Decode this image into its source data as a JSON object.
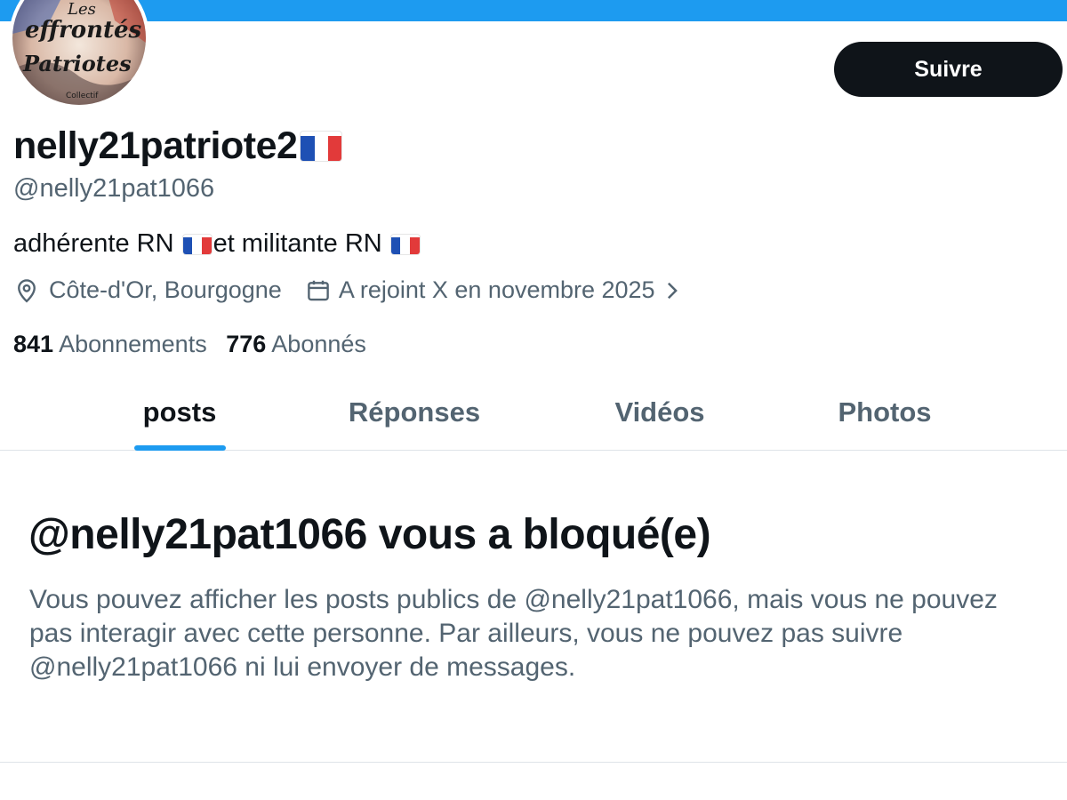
{
  "profile": {
    "display_name": "nelly21patriote2",
    "handle": "@nelly21pat1066",
    "bio_part1": "adhérente RN",
    "bio_part2": "et militante RN",
    "location": "Côte-d'Or, Bourgogne",
    "joined": "A rejoint X en novembre 2025",
    "following_count": "841",
    "following_label": "Abonnements",
    "followers_count": "776",
    "followers_label": "Abonnés",
    "avatar_text": {
      "line1": "Les",
      "line2": "effrontés",
      "line3": "Patriotes",
      "line4": "Collectif"
    }
  },
  "actions": {
    "follow_label": "Suivre"
  },
  "tabs": [
    {
      "label": "posts",
      "active": true
    },
    {
      "label": "Réponses",
      "active": false
    },
    {
      "label": "Vidéos",
      "active": false
    },
    {
      "label": "Photos",
      "active": false
    }
  ],
  "blocked": {
    "title": "@nelly21pat1066 vous a bloqué(e)",
    "message": "Vous pouvez afficher les posts publics de @nelly21pat1066, mais vous ne pouvez pas interagir avec cette personne. Par ailleurs, vous ne pouvez pas suivre @nelly21pat1066 ni lui envoyer de messages."
  },
  "icons": {
    "location": "location-pin-icon",
    "calendar": "calendar-icon",
    "chevron": "chevron-right-icon",
    "flag": "france-flag-emoji"
  },
  "colors": {
    "accent": "#1d9bf0",
    "text_primary": "#0f1419",
    "text_secondary": "#536471",
    "button_bg": "#0f1419",
    "button_text": "#ffffff"
  }
}
